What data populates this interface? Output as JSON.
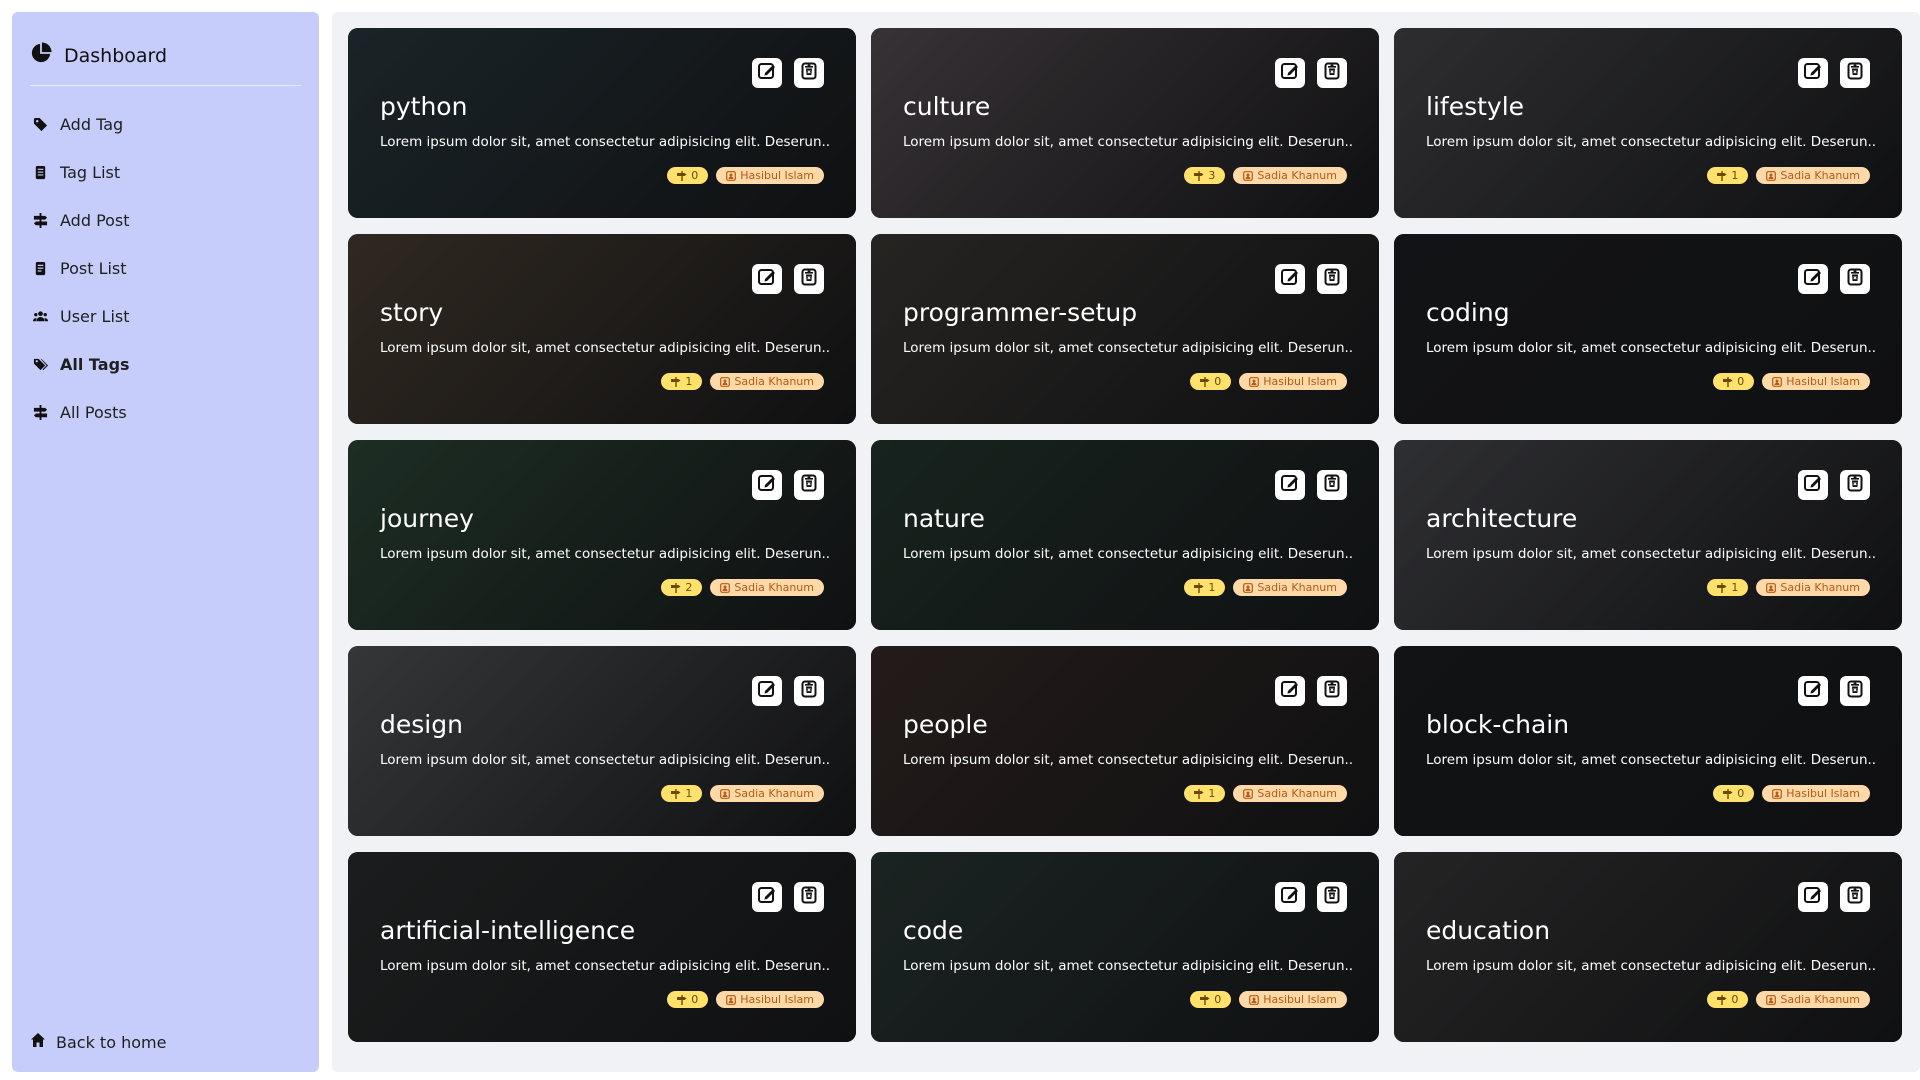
{
  "sidebar": {
    "title": "Dashboard",
    "items": [
      {
        "label": "Add Tag",
        "icon": "tag-icon"
      },
      {
        "label": "Tag List",
        "icon": "list-icon"
      },
      {
        "label": "Add Post",
        "icon": "signpost-icon"
      },
      {
        "label": "Post List",
        "icon": "document-icon"
      },
      {
        "label": "User List",
        "icon": "users-icon"
      },
      {
        "label": "All Tags",
        "icon": "tags-icon",
        "active": true
      },
      {
        "label": "All Posts",
        "icon": "signpost-icon"
      }
    ],
    "back_label": "Back to home"
  },
  "description": "Lorem ipsum dolor sit, amet consectetur adipisicing elit. Deserun...",
  "cards": [
    {
      "title": "python",
      "count": "0",
      "author": "Hasibul Islam",
      "bg": "#2b3a40"
    },
    {
      "title": "culture",
      "count": "3",
      "author": "Sadia Khanum",
      "bg": "#5a5156"
    },
    {
      "title": "lifestyle",
      "count": "1",
      "author": "Sadia Khanum",
      "bg": "#4a4a4e"
    },
    {
      "title": "story",
      "count": "1",
      "author": "Sadia Khanum",
      "bg": "#4d4235"
    },
    {
      "title": "programmer-setup",
      "count": "0",
      "author": "Hasibul Islam",
      "bg": "#3e3b37"
    },
    {
      "title": "coding",
      "count": "0",
      "author": "Hasibul Islam",
      "bg": "#1e2024"
    },
    {
      "title": "journey",
      "count": "2",
      "author": "Sadia Khanum",
      "bg": "#2f4a3a"
    },
    {
      "title": "nature",
      "count": "1",
      "author": "Sadia Khanum",
      "bg": "#263a31"
    },
    {
      "title": "architecture",
      "count": "1",
      "author": "Sadia Khanum",
      "bg": "#4c4d52"
    },
    {
      "title": "design",
      "count": "1",
      "author": "Sadia Khanum",
      "bg": "#56585a"
    },
    {
      "title": "people",
      "count": "1",
      "author": "Sadia Khanum",
      "bg": "#3a2d2a"
    },
    {
      "title": "block-chain",
      "count": "0",
      "author": "Hasibul Islam",
      "bg": "#1c1f22"
    },
    {
      "title": "artificial-intelligence",
      "count": "0",
      "author": "Hasibul Islam",
      "bg": "#2c2f30"
    },
    {
      "title": "code",
      "count": "0",
      "author": "Hasibul Islam",
      "bg": "#2c3a38"
    },
    {
      "title": "education",
      "count": "0",
      "author": "Sadia Khanum",
      "bg": "#3b3a3b"
    }
  ]
}
